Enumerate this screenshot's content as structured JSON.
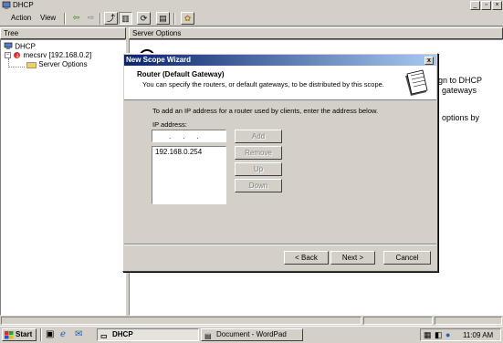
{
  "window": {
    "title": "DHCP"
  },
  "menu": {
    "action": "Action",
    "view": "View"
  },
  "panels": {
    "tree_header": "Tree",
    "right_header": "Server Options"
  },
  "tree": {
    "root": "DHCP",
    "server": "mecsrv [192.168.0.2]",
    "options": "Server Options"
  },
  "right_pane": {
    "line1": "gn to DHCP",
    "line2": "gateways",
    "line3": "options by"
  },
  "wizard": {
    "title": "New Scope Wizard",
    "close": "x",
    "heading": "Router (Default Gateway)",
    "subheading": "You can specify the routers, or default gateways, to be distributed by this scope.",
    "instruction": "To add an IP address for a router used by clients, enter the address below.",
    "ip_label": "IP address:",
    "ip_placeholder": ". . .",
    "list": [
      "192.168.0.254"
    ],
    "buttons": {
      "add": "Add",
      "remove": "Remove",
      "up": "Up",
      "down": "Down",
      "back": "< Back",
      "next": "Next >",
      "cancel": "Cancel"
    }
  },
  "taskbar": {
    "start": "Start",
    "tasks": [
      "DHCP",
      "Document - WordPad"
    ],
    "clock": "11:09 AM"
  },
  "colors": {
    "titlebar_start": "#0a246a",
    "titlebar_end": "#a6caf0",
    "face": "#d4d0c8"
  }
}
